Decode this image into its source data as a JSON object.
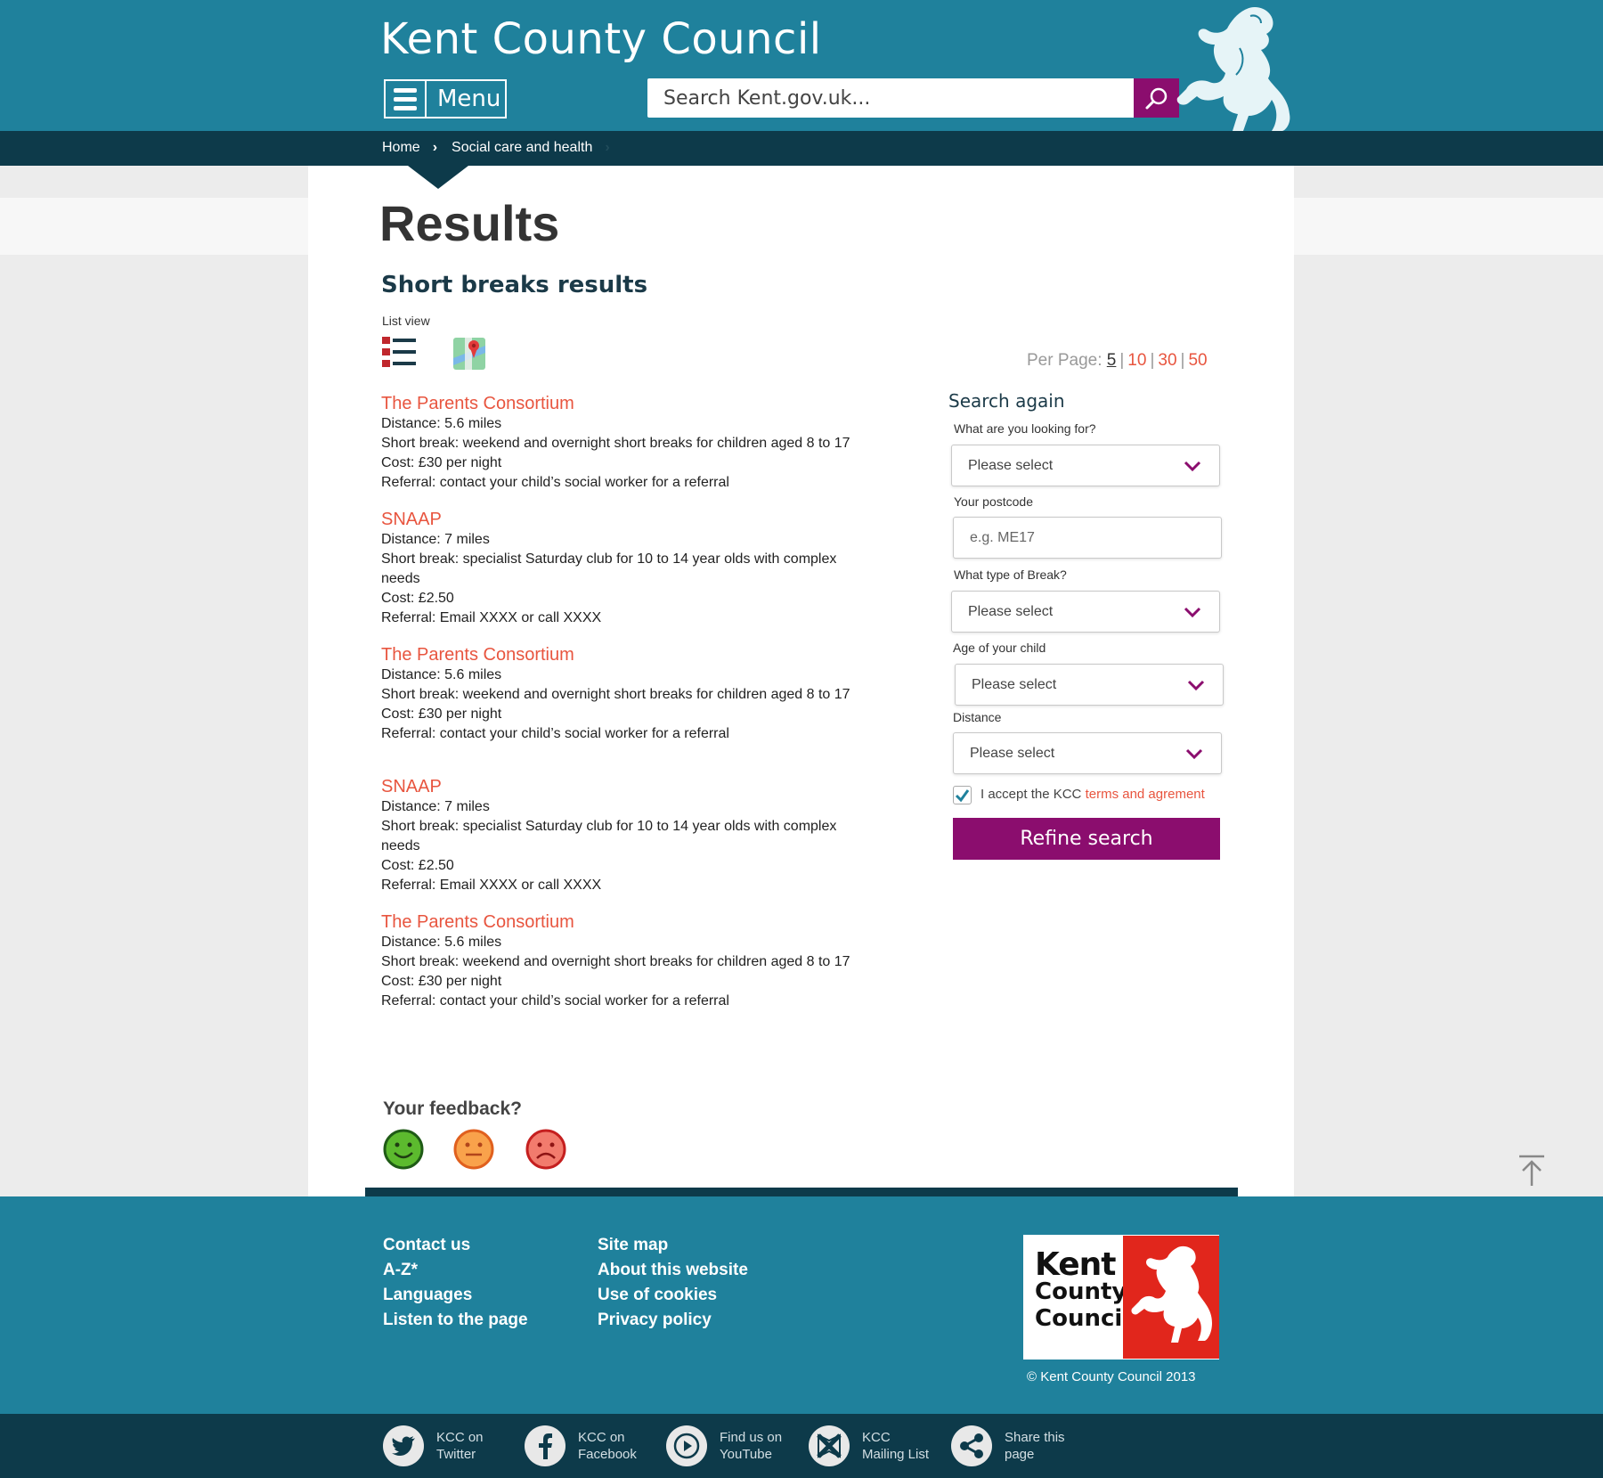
{
  "header": {
    "site_title": "Kent County Council",
    "menu_label": "Menu",
    "search_placeholder": "Search Kent.gov.uk..."
  },
  "breadcrumb": [
    "Home",
    "Social care and health"
  ],
  "main": {
    "title": "Results",
    "subtitle": "Short breaks results",
    "view_label": "List view",
    "per_page_label": "Per Page:",
    "per_page_options": [
      "5",
      "10",
      "30",
      "50"
    ],
    "per_page_selected": "5"
  },
  "results": [
    {
      "title": "The Parents Consortium",
      "distance": "Distance: 5.6 miles",
      "short_break": "Short break: weekend and overnight short breaks for children aged 8 to 17",
      "cost": "Cost: £30 per night",
      "referral": "Referral: contact your child’s social worker for a referral"
    },
    {
      "title": "SNAAP",
      "distance": "Distance: 7 miles",
      "short_break": "Short break: specialist Saturday club for 10 to 14 year olds with complex needs",
      "cost": "Cost: £2.50",
      "referral": "Referral: Email XXXX or call XXXX"
    },
    {
      "title": "The Parents Consortium",
      "distance": "Distance: 5.6 miles",
      "short_break": "Short break: weekend and overnight short breaks for children aged 8 to 17",
      "cost": "Cost: £30 per night",
      "referral": "Referral: contact your child’s social worker for a referral"
    },
    {
      "title": "SNAAP",
      "distance": "Distance: 7 miles",
      "short_break": "Short break: specialist Saturday club for 10 to 14 year olds with complex needs",
      "cost": "Cost: £2.50",
      "referral": "Referral: Email XXXX or call XXXX"
    },
    {
      "title": "The Parents Consortium",
      "distance": "Distance: 5.6 miles",
      "short_break": "Short break: weekend and overnight short breaks for children aged 8 to 17",
      "cost": "Cost: £30 per night",
      "referral": "Referral: contact your child’s social worker for a referral"
    }
  ],
  "search_again": {
    "heading": "Search again",
    "looking_for_label": "What are you looking for?",
    "looking_for_value": "Please select",
    "postcode_label": "Your postcode",
    "postcode_placeholder": "e.g. ME17",
    "break_type_label": "What type of Break?",
    "break_type_value": "Please select",
    "age_label": "Age of your child",
    "age_value": "Please select",
    "distance_label": "Distance",
    "distance_value": "Please select",
    "terms_prefix": "I accept the KCC",
    "terms_link": "terms and agrement",
    "terms_checked": true,
    "refine_label": "Refine search"
  },
  "feedback": {
    "title": "Your feedback?",
    "faces": [
      "happy-face-icon",
      "neutral-face-icon",
      "sad-face-icon"
    ]
  },
  "footer": {
    "col1": [
      "Contact us",
      "A-Z*",
      "Languages",
      "Listen to the page"
    ],
    "col2": [
      "Site map",
      "About this website",
      "Use of cookies",
      "Privacy policy"
    ],
    "logo_lines": [
      "Kent",
      "County",
      "Council"
    ],
    "copyright": "© Kent County Council 2013"
  },
  "social": [
    {
      "icon": "twitter-icon",
      "line1": "KCC on",
      "line2": "Twitter"
    },
    {
      "icon": "facebook-icon",
      "line1": "KCC on",
      "line2": "Facebook"
    },
    {
      "icon": "youtube-icon",
      "line1": "Find us on",
      "line2": "YouTube"
    },
    {
      "icon": "mail-icon",
      "line1": "KCC",
      "line2": "Mailing List"
    },
    {
      "icon": "share-icon",
      "line1": "Share this",
      "line2": "page"
    }
  ],
  "colors": {
    "header_teal": "#1f819c",
    "dark_navy": "#0d3a4a",
    "accent_purple": "#8b0d6e",
    "link_orange": "#e8553f"
  }
}
